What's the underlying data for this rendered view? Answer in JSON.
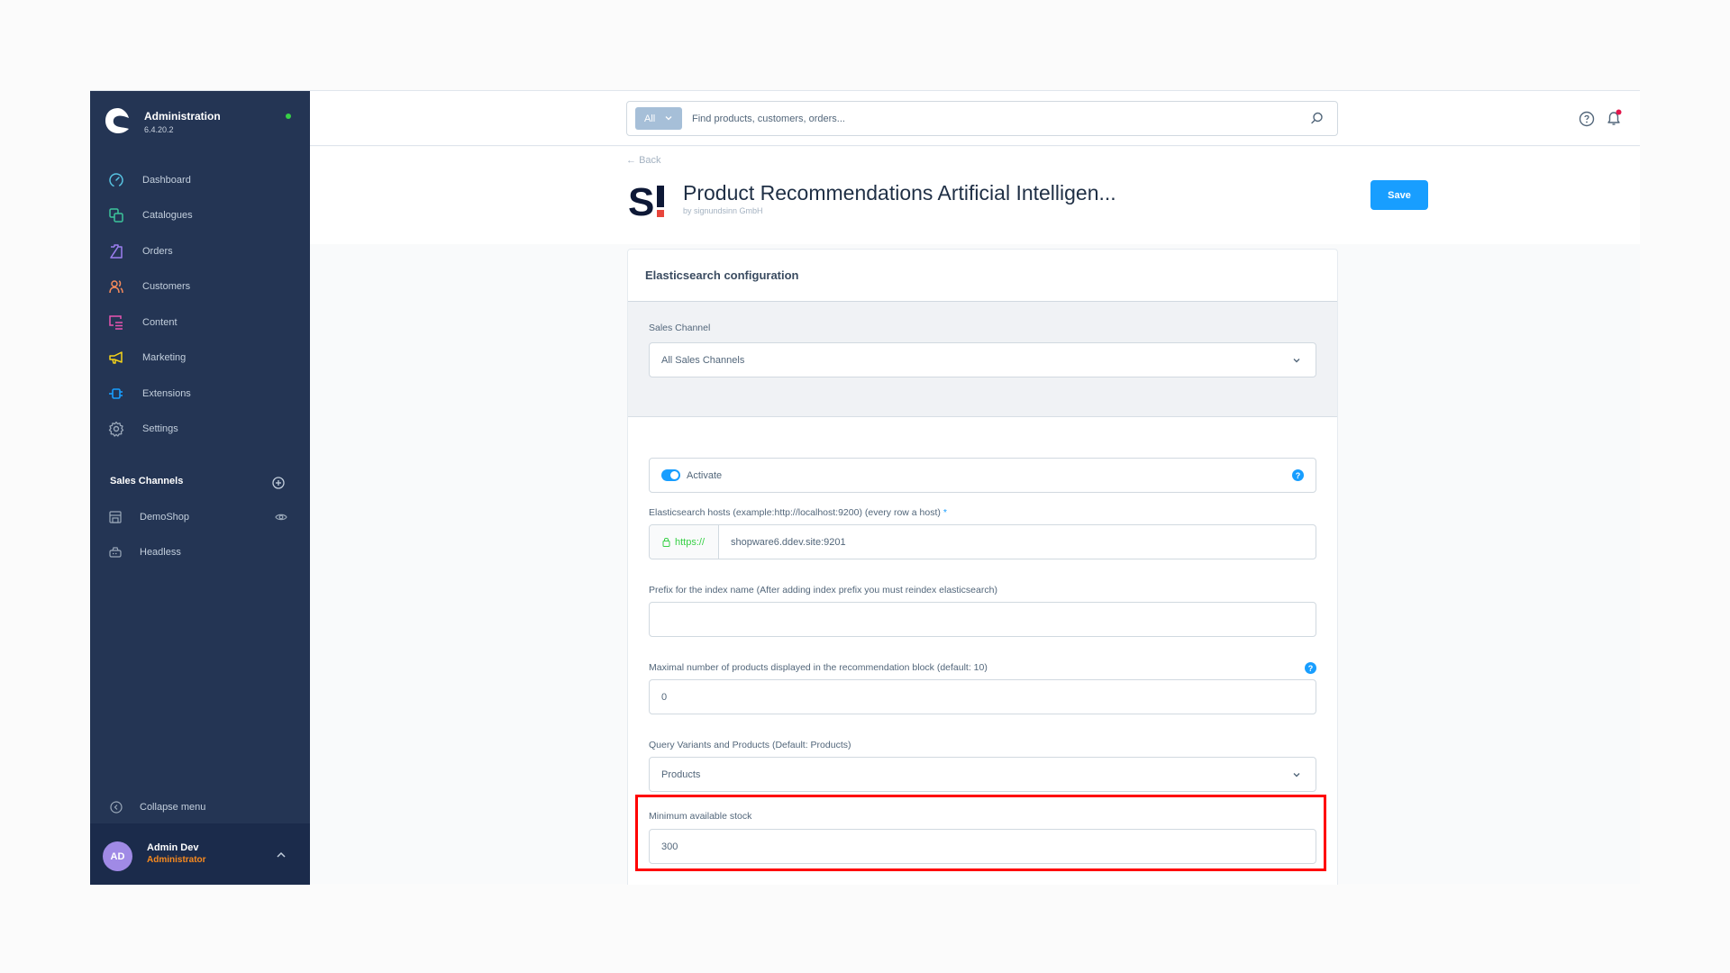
{
  "app": {
    "title": "Administration",
    "version": "6.4.20.2",
    "status_color": "#37d046"
  },
  "sidebar": {
    "items": [
      {
        "label": "Dashboard",
        "icon": "dashboard-icon",
        "color": "#57c2e0"
      },
      {
        "label": "Catalogues",
        "icon": "catalogues-icon",
        "color": "#3cc59b"
      },
      {
        "label": "Orders",
        "icon": "orders-icon",
        "color": "#9c7ff0"
      },
      {
        "label": "Customers",
        "icon": "customers-icon",
        "color": "#f58a5b"
      },
      {
        "label": "Content",
        "icon": "content-icon",
        "color": "#e854b0"
      },
      {
        "label": "Marketing",
        "icon": "marketing-icon",
        "color": "#f5d319"
      },
      {
        "label": "Extensions",
        "icon": "extensions-icon",
        "color": "#189eff"
      },
      {
        "label": "Settings",
        "icon": "settings-icon",
        "color": "#9aa8b9"
      }
    ],
    "sales_channels": {
      "title": "Sales Channels",
      "items": [
        {
          "label": "DemoShop",
          "icon": "storefront-icon"
        },
        {
          "label": "Headless",
          "icon": "headless-icon"
        }
      ]
    },
    "collapse_label": "Collapse menu",
    "user": {
      "initials": "AD",
      "name": "Admin Dev",
      "role": "Administrator"
    }
  },
  "topbar": {
    "search_type": "All",
    "search_placeholder": "Find products, customers, orders..."
  },
  "page": {
    "back_label": "Back",
    "title": "Product Recommendations Artificial Intelligen...",
    "subtitle": "by signundsinn GmbH",
    "save_label": "Save"
  },
  "card": {
    "title": "Elasticsearch configuration",
    "sales_channel": {
      "label": "Sales Channel",
      "value": "All Sales Channels"
    },
    "activate": {
      "label": "Activate",
      "enabled": true
    },
    "hosts": {
      "label": "Elasticsearch hosts (example:http://localhost:9200) (every row a host)",
      "required_mark": "*",
      "prefix": "https://",
      "value": "shopware6.ddev.site:9201"
    },
    "index_prefix": {
      "label": "Prefix for the index name (After adding index prefix you must reindex elasticsearch)",
      "value": ""
    },
    "max_products": {
      "label": "Maximal number of products displayed in the recommendation block (default: 10)",
      "value": "0"
    },
    "query_variants": {
      "label": "Query Variants and Products (Default: Products)",
      "value": "Products"
    },
    "min_stock": {
      "label": "Minimum available stock",
      "value": "300"
    }
  },
  "colors": {
    "sidebar_bg": "#243554",
    "accent": "#189eff",
    "highlight": "#ff0000",
    "role": "#f88a1f"
  }
}
